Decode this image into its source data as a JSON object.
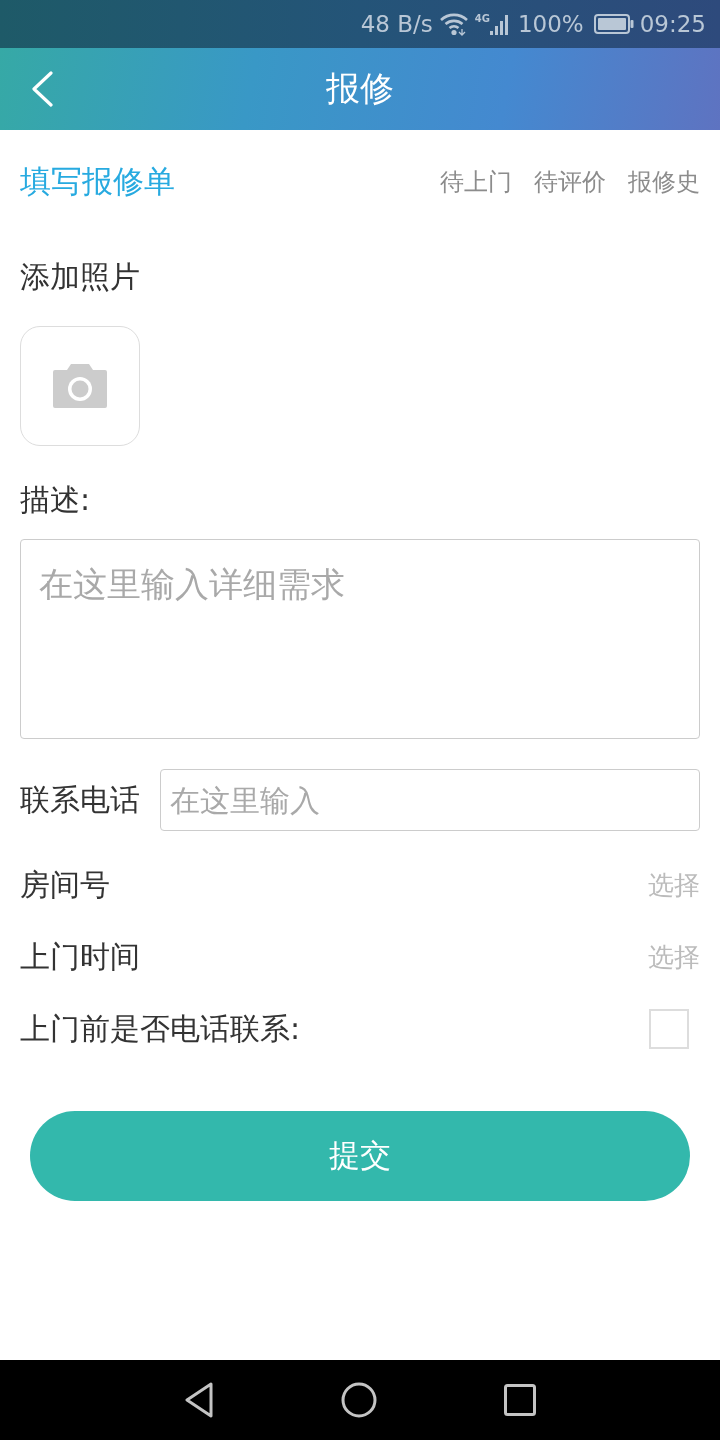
{
  "status_bar": {
    "net_speed": "48 B/s",
    "network": "4G",
    "battery": "100%",
    "time": "09:25"
  },
  "header": {
    "title": "报修"
  },
  "tabs": [
    {
      "label": "填写报修单",
      "selected": true
    },
    {
      "label": "待上门",
      "selected": false
    },
    {
      "label": "待评价",
      "selected": false
    },
    {
      "label": "报修史",
      "selected": false
    }
  ],
  "form": {
    "photo_label": "添加照片",
    "description_label": "描述:",
    "description": {
      "placeholder": "在这里输入详细需求"
    },
    "phone": {
      "label": "联系电话",
      "placeholder": "在这里输入"
    },
    "pickers": [
      {
        "label": "房间号",
        "value": "选择"
      },
      {
        "label": "上门时间",
        "value": "选择"
      }
    ],
    "call_before": {
      "label": "上门前是否电话联系:",
      "checked": false
    }
  },
  "submit": {
    "label": "提交"
  }
}
